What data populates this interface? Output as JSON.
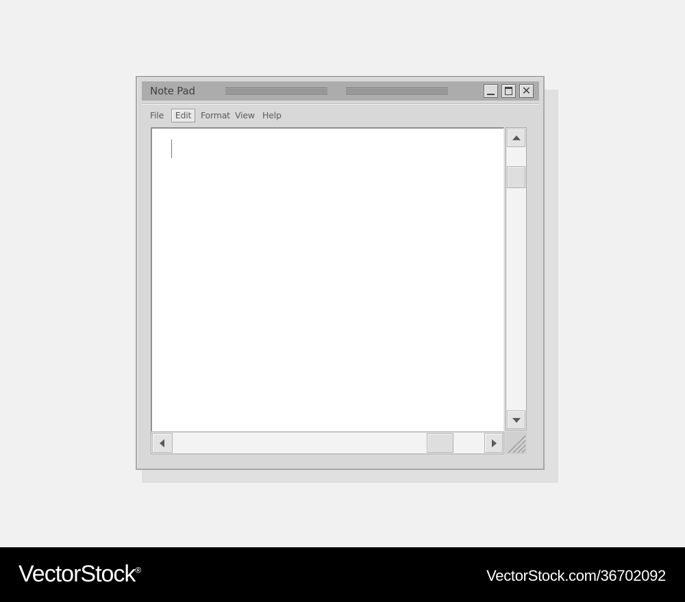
{
  "window": {
    "title": "Note Pad"
  },
  "titlebar": {
    "buttons": [
      {
        "name": "minimize",
        "icon": "minimize-icon"
      },
      {
        "name": "maximize",
        "icon": "maximize-icon"
      },
      {
        "name": "close",
        "icon": "close-icon",
        "glyph": "✕"
      }
    ]
  },
  "menu": {
    "items": [
      {
        "label": "File",
        "selected": false
      },
      {
        "label": "Edit",
        "selected": true
      },
      {
        "label": "Format",
        "selected": false
      },
      {
        "label": "View",
        "selected": false
      },
      {
        "label": "Help",
        "selected": false
      }
    ]
  },
  "editor": {
    "content": "",
    "caret_visible": true
  },
  "scrollbars": {
    "vertical": {
      "icons": [
        "arrow-up-icon",
        "arrow-down-icon"
      ]
    },
    "horizontal": {
      "icons": [
        "arrow-left-icon",
        "arrow-right-icon"
      ]
    }
  },
  "watermark": {
    "brand": "VectorStock",
    "registered_mark": "®",
    "url": "VectorStock.com/36702092"
  },
  "colors": {
    "background": "#f1f1f1",
    "window": "#d8d8d8",
    "titlebar": "#acacac",
    "editor": "#ffffff",
    "watermark_bar": "#000000"
  }
}
